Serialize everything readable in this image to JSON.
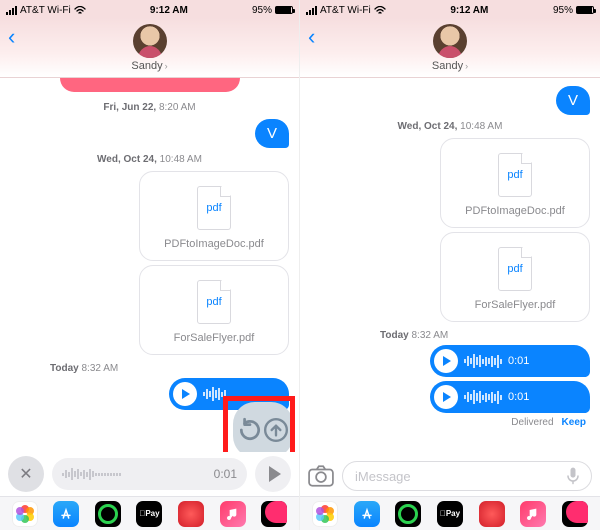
{
  "statusbar": {
    "carrier": "AT&T Wi-Fi",
    "time": "9:12 AM",
    "battery_pct": "95%"
  },
  "header": {
    "contact_name": "Sandy"
  },
  "left": {
    "ts1_bold": "Fri, Jun 22,",
    "ts1_time": "8:20 AM",
    "bubble_v": "V",
    "ts2_bold": "Wed, Oct 24,",
    "ts2_time": "10:48 AM",
    "file1_type": "pdf",
    "file1_name": "PDFtoImageDoc.pdf",
    "file2_type": "pdf",
    "file2_name": "ForSaleFlyer.pdf",
    "today_bold": "Today",
    "today_time": "8:32 AM",
    "record_duration": "0:01"
  },
  "right": {
    "bubble_v": "V",
    "ts2_bold": "Wed, Oct 24,",
    "ts2_time": "10:48 AM",
    "file1_type": "pdf",
    "file1_name": "PDFtoImageDoc.pdf",
    "file2_type": "pdf",
    "file2_name": "ForSaleFlyer.pdf",
    "today_bold": "Today",
    "today_time": "8:32 AM",
    "audio1_dur": "0:01",
    "audio2_dur": "0:01",
    "delivered": "Delivered",
    "keep": "Keep",
    "input_placeholder": "iMessage"
  },
  "dock": {
    "pay_label": "Pay"
  }
}
